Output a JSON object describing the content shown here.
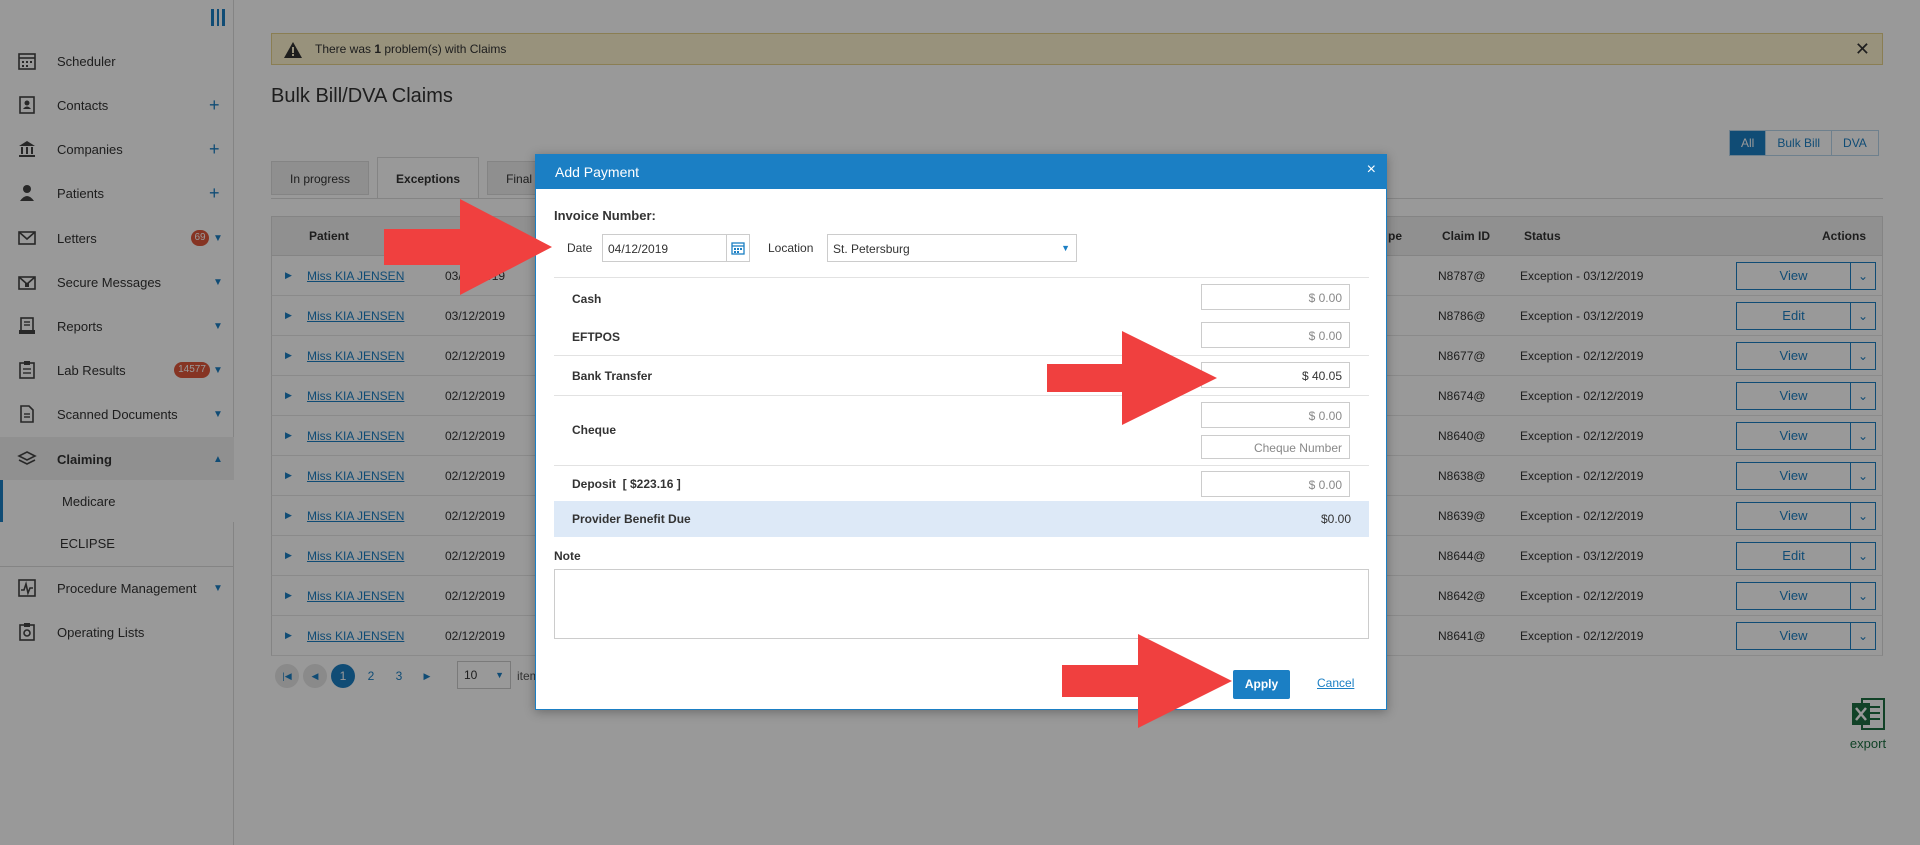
{
  "sidebar": {
    "items": [
      {
        "label": "Scheduler",
        "icon": "calendar-icon",
        "plus": "",
        "chevron": "",
        "badge": ""
      },
      {
        "label": "Contacts",
        "icon": "contacts-icon",
        "plus": "+",
        "chevron": "",
        "badge": ""
      },
      {
        "label": "Companies",
        "icon": "bank-icon",
        "plus": "+",
        "chevron": "",
        "badge": ""
      },
      {
        "label": "Patients",
        "icon": "person-icon",
        "plus": "+",
        "chevron": "",
        "badge": ""
      },
      {
        "label": "Letters",
        "icon": "envelope-icon",
        "plus": "",
        "chevron": "▼",
        "badge": "69"
      },
      {
        "label": "Secure Messages",
        "icon": "secure-mail-icon",
        "plus": "",
        "chevron": "▼",
        "badge": ""
      },
      {
        "label": "Reports",
        "icon": "report-icon",
        "plus": "",
        "chevron": "▼",
        "badge": ""
      },
      {
        "label": "Lab Results",
        "icon": "clipboard-icon",
        "plus": "",
        "chevron": "▼",
        "badge": "14577"
      },
      {
        "label": "Scanned Documents",
        "icon": "document-icon",
        "plus": "",
        "chevron": "▼",
        "badge": ""
      },
      {
        "label": "Claiming",
        "icon": "layers-icon",
        "plus": "",
        "chevron": "▲",
        "badge": ""
      }
    ],
    "sub_items": [
      {
        "label": "Medicare"
      },
      {
        "label": "ECLIPSE"
      }
    ],
    "bottom_items": [
      {
        "label": "Procedure Management",
        "icon": "procedure-icon",
        "chevron": "▼"
      },
      {
        "label": "Operating Lists",
        "icon": "operating-list-icon",
        "chevron": ""
      }
    ]
  },
  "alert": {
    "text_before": "There was ",
    "count": "1",
    "text_after": " problem(s) with Claims",
    "close": "✕"
  },
  "page": {
    "title": "Bulk Bill/DVA Claims"
  },
  "filters": [
    "All",
    "Bulk Bill",
    "DVA"
  ],
  "tabs": [
    "In progress",
    "Exceptions",
    "Final"
  ],
  "grid": {
    "headers": {
      "patient": "Patient",
      "type": "pe",
      "claim_id": "Claim ID",
      "status": "Status",
      "actions": "Actions"
    },
    "rows": [
      {
        "patient": "Miss KIA JENSEN",
        "date": "03/12/2019",
        "claim_id": "N8787@",
        "status": "Exception - 03/12/2019",
        "action": "View"
      },
      {
        "patient": "Miss KIA JENSEN",
        "date": "03/12/2019",
        "claim_id": "N8786@",
        "status": "Exception - 03/12/2019",
        "action": "Edit"
      },
      {
        "patient": "Miss KIA JENSEN",
        "date": "02/12/2019",
        "claim_id": "N8677@",
        "status": "Exception - 02/12/2019",
        "action": "View"
      },
      {
        "patient": "Miss KIA JENSEN",
        "date": "02/12/2019",
        "claim_id": "N8674@",
        "status": "Exception - 02/12/2019",
        "action": "View"
      },
      {
        "patient": "Miss KIA JENSEN",
        "date": "02/12/2019",
        "claim_id": "N8640@",
        "status": "Exception - 02/12/2019",
        "action": "View"
      },
      {
        "patient": "Miss KIA JENSEN",
        "date": "02/12/2019",
        "claim_id": "N8638@",
        "status": "Exception - 02/12/2019",
        "action": "View"
      },
      {
        "patient": "Miss KIA JENSEN",
        "date": "02/12/2019",
        "claim_id": "N8639@",
        "status": "Exception - 02/12/2019",
        "action": "View"
      },
      {
        "patient": "Miss KIA JENSEN",
        "date": "02/12/2019",
        "claim_id": "N8644@",
        "status": "Exception - 03/12/2019",
        "action": "Edit"
      },
      {
        "patient": "Miss KIA JENSEN",
        "date": "02/12/2019",
        "claim_id": "N8642@",
        "status": "Exception - 02/12/2019",
        "action": "View"
      },
      {
        "patient": "Miss KIA JENSEN",
        "date": "02/12/2019",
        "claim_id": "N8641@",
        "status": "Exception - 02/12/2019",
        "action": "View"
      }
    ]
  },
  "pager": {
    "pages": [
      "1",
      "2",
      "3"
    ],
    "active_page": "1",
    "page_size": "10",
    "items_label": "item"
  },
  "export": {
    "label": "export"
  },
  "modal": {
    "title": "Add Payment",
    "close": "×",
    "invoice_label": "Invoice Number:",
    "date_label": "Date",
    "date_value": "04/12/2019",
    "location_label": "Location",
    "location_value": "St. Petersburg",
    "cash_label": "Cash",
    "cash_value": "$ 0.00",
    "eftpos_label": "EFTPOS",
    "eftpos_value": "$ 0.00",
    "bank_label": "Bank Transfer",
    "bank_value": "$ 40.05",
    "cheque_label": "Cheque",
    "cheque_value": "$ 0.00",
    "cheque_number_placeholder": "Cheque Number",
    "deposit_label": "Deposit  [ $223.16 ]",
    "deposit_value": "$ 0.00",
    "benefit_label": "Provider Benefit Due",
    "benefit_value": "$0.00",
    "note_label": "Note",
    "note_value": "",
    "apply": "Apply",
    "cancel": "Cancel"
  },
  "colors": {
    "accent": "#1b7fc4",
    "alert_bg": "#fdf3cf",
    "badge": "#e0583b",
    "arrow": "#f0403f",
    "excel": "#1d6f42"
  }
}
